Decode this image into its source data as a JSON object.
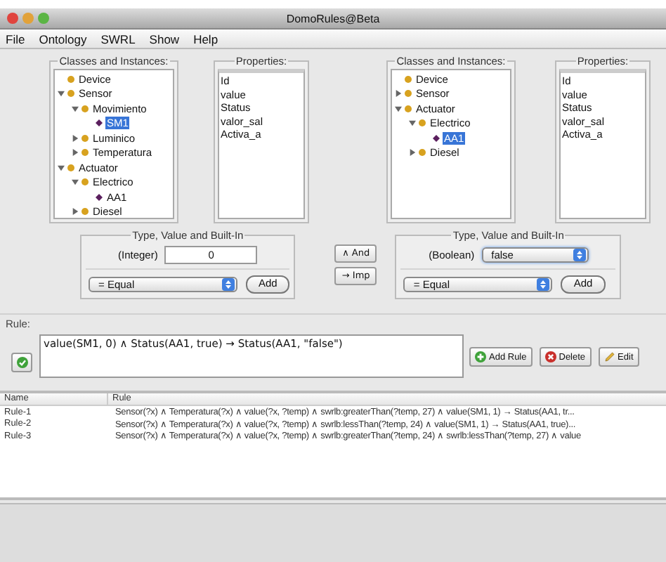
{
  "window": {
    "title": "DomoRules@Beta"
  },
  "menu": [
    "File",
    "Ontology",
    "SWRL",
    "Show",
    "Help"
  ],
  "panes": [
    {
      "tree_title": "Classes and Instances:",
      "tree": [
        {
          "label": "Device",
          "kind": "class",
          "selected": false
        },
        {
          "label": "Sensor",
          "kind": "class",
          "expanded": true,
          "selected": false,
          "children": [
            {
              "label": "Movimiento",
              "kind": "class",
              "expanded": true,
              "selected": false,
              "children": [
                {
                  "label": "SM1",
                  "kind": "instance",
                  "selected": true
                }
              ]
            },
            {
              "label": "Luminico",
              "kind": "class",
              "expanded": false,
              "selected": false
            },
            {
              "label": "Temperatura",
              "kind": "class",
              "expanded": false,
              "selected": false
            }
          ]
        },
        {
          "label": "Actuator",
          "kind": "class",
          "expanded": true,
          "selected": false,
          "children": [
            {
              "label": "Electrico",
              "kind": "class",
              "expanded": true,
              "selected": false,
              "children": [
                {
                  "label": "AA1",
                  "kind": "instance",
                  "selected": false
                }
              ]
            },
            {
              "label": "Diesel",
              "kind": "class",
              "expanded": false,
              "selected": false
            }
          ]
        }
      ],
      "properties_title": "Properties:",
      "properties": [
        "Id",
        "value",
        "Status",
        "valor_sal",
        "Activa_a"
      ],
      "builtin": {
        "title": "Type, Value and Built-In",
        "type_label": "(Integer)",
        "kind": "text",
        "value": "0",
        "operator": "= Equal",
        "add": "Add"
      }
    },
    {
      "tree_title": "Classes and Instances:",
      "tree": [
        {
          "label": "Device",
          "kind": "class",
          "selected": false
        },
        {
          "label": "Sensor",
          "kind": "class",
          "expanded": false,
          "selected": false
        },
        {
          "label": "Actuator",
          "kind": "class",
          "expanded": true,
          "selected": false,
          "children": [
            {
              "label": "Electrico",
              "kind": "class",
              "expanded": true,
              "selected": false,
              "children": [
                {
                  "label": "AA1",
                  "kind": "instance",
                  "selected": true
                }
              ]
            },
            {
              "label": "Diesel",
              "kind": "class",
              "expanded": false,
              "selected": false
            }
          ]
        }
      ],
      "properties_title": "Properties:",
      "properties": [
        "Id",
        "value",
        "Status",
        "valor_sal",
        "Activa_a"
      ],
      "builtin": {
        "title": "Type, Value and Built-In",
        "type_label": "(Boolean)",
        "kind": "select",
        "value": "false",
        "operator": "= Equal",
        "add": "Add"
      }
    }
  ],
  "connectors": [
    "∧ And",
    "→ Imp"
  ],
  "rule": {
    "label": "Rule:",
    "text": "value(SM1, 0) ∧ Status(AA1, true)  → Status(AA1, \"false\")",
    "buttons": [
      {
        "label": "Add Rule",
        "kind": "add"
      },
      {
        "label": "Delete",
        "kind": "delete"
      },
      {
        "label": "Edit",
        "kind": "edit"
      }
    ]
  },
  "table": {
    "columns": [
      "Name",
      "Rule"
    ],
    "rows": [
      {
        "name": "Rule-1",
        "rule": "Sensor(?x) ∧ Temperatura(?x)  ∧  value(?x, ?temp)  ∧ swrlb:greaterThan(?temp, 27) ∧  value(SM1, 1)  → Status(AA1, tr..."
      },
      {
        "name": "Rule-2",
        "rule": "Sensor(?x) ∧ Temperatura(?x)  ∧  value(?x, ?temp)  ∧ swrlb:lessThan(?temp, 24) ∧  value(SM1, 1)  → Status(AA1, true)..."
      },
      {
        "name": "Rule-3",
        "rule": "Sensor(?x) ∧ Temperatura(?x)  ∧  value(?x, ?temp)  ∧ swrlb:greaterThan(?temp, 24) ∧ swrlb:lessThan(?temp, 27)  ∧ value"
      }
    ]
  }
}
